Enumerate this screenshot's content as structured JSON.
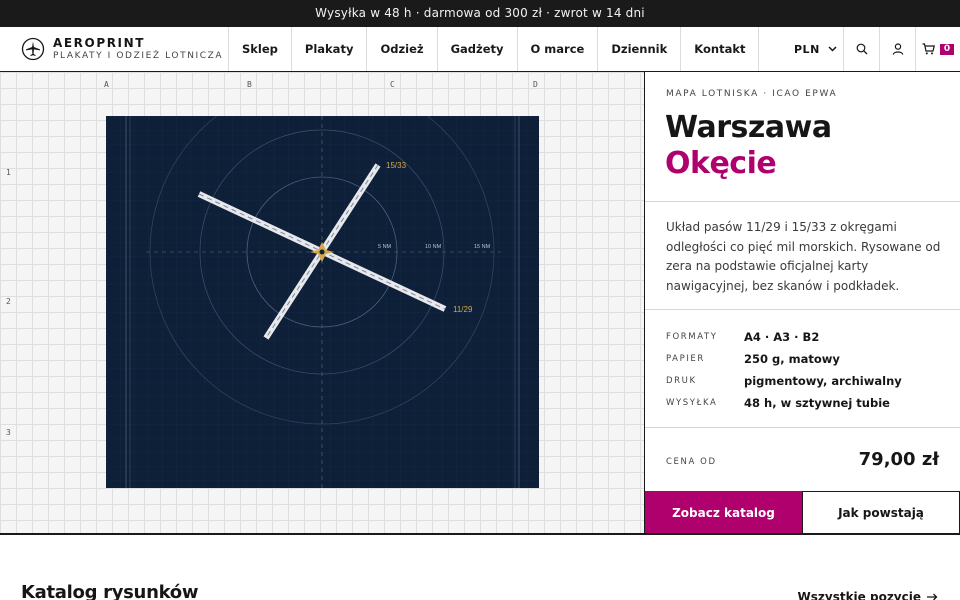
{
  "announcement": "Wysyłka w 48 h · darmowa od 300 zł · zwrot w 14 dni",
  "brand": {
    "name": "AEROPRINT",
    "tagline": "PLAKATY I ODZIEŻ LOTNICZA",
    "icon": "airplane-icon"
  },
  "nav": {
    "items": [
      "Sklep",
      "Plakaty",
      "Odzież",
      "Gadżety",
      "O marce",
      "Dziennik",
      "Kontakt"
    ]
  },
  "tools": {
    "currency": "PLN",
    "search_icon": "search-icon",
    "account_icon": "user-icon",
    "cart_icon": "cart-icon",
    "cart_count": "0"
  },
  "canvas": {
    "columns": [
      "A",
      "B",
      "C",
      "D"
    ],
    "rows": [
      "1",
      "2",
      "3"
    ],
    "map": {
      "runway_a": "15/33",
      "runway_b": "11/29",
      "rings": [
        "5 NM",
        "10 NM",
        "15 NM"
      ]
    }
  },
  "product": {
    "kicker": "MAPA LOTNISKA · ICAO EPWA",
    "title_line1": "Warszawa",
    "title_line2": "Okęcie",
    "description": "Układ pasów 11/29 i 15/33 z okręgami odległości co pięć mil morskich. Rysowane od zera na podstawie oficjalnej karty nawigacyjnej, bez skanów i podkładek.",
    "specs": [
      {
        "key": "FORMATY",
        "value": "A4 · A3 · B2"
      },
      {
        "key": "PAPIER",
        "value": "250 g, matowy"
      },
      {
        "key": "DRUK",
        "value": "pigmentowy, archiwalny"
      },
      {
        "key": "WYSYŁKA",
        "value": "48 h, w sztywnej tubie"
      }
    ],
    "price_label": "CENA OD",
    "price": "79,00 zł",
    "primary_button": "Zobacz katalog",
    "secondary_button": "Jak powstają"
  },
  "catalog": {
    "title": "Katalog rysunków",
    "link": "Wszystkie pozycje"
  },
  "colors": {
    "accent": "#b0006e",
    "map_bg": "#0e1f38",
    "dark": "#1a1a1a",
    "runway_label": "#d4a84a"
  }
}
